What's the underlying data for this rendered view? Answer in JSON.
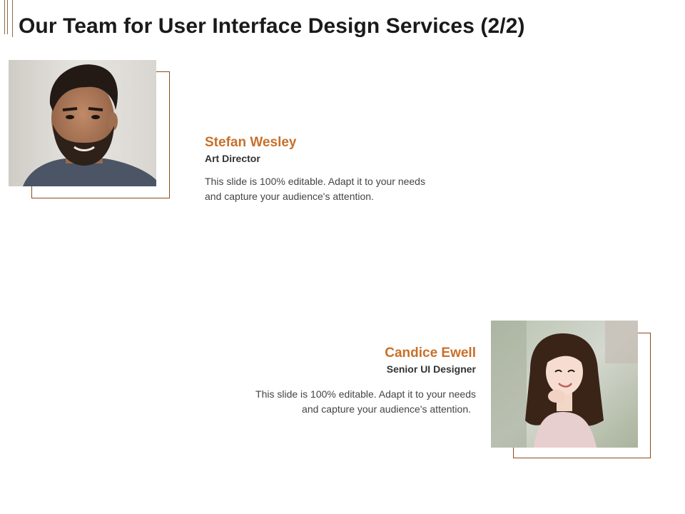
{
  "slide": {
    "title": "Our Team for User Interface Design Services (2/2)",
    "accent_color": "#c8702a",
    "frame_color": "#8a4b1e"
  },
  "members": [
    {
      "name": "Stefan Wesley",
      "role": "Art Director",
      "description_line1": "This slide is 100% editable. Adapt it to your needs",
      "description_line2": "and capture your audience's attention.",
      "photo_icon": "man-portrait-photo"
    },
    {
      "name": "Candice Ewell",
      "role": "Senior UI Designer",
      "description_line1": "This slide is 100% editable. Adapt it to your needs",
      "description_line2": "and capture your audience's attention.",
      "photo_icon": "woman-portrait-photo"
    }
  ]
}
